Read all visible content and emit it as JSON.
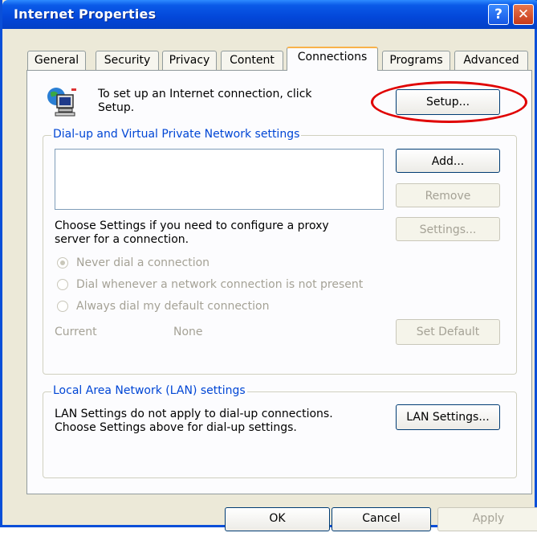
{
  "window": {
    "title": "Internet Properties",
    "help_glyph": "?",
    "close_glyph": "✕"
  },
  "tabs": [
    {
      "label": "General"
    },
    {
      "label": "Security"
    },
    {
      "label": "Privacy"
    },
    {
      "label": "Content"
    },
    {
      "label": "Connections",
      "active": true
    },
    {
      "label": "Programs"
    },
    {
      "label": "Advanced"
    }
  ],
  "setup": {
    "icon": "globe-computer-icon",
    "text_line1": "To set up an Internet connection, click",
    "text_line2": "Setup.",
    "button": "Setup..."
  },
  "dialup": {
    "legend": "Dial-up and Virtual Private Network settings",
    "add": "Add...",
    "remove": "Remove",
    "settings": "Settings...",
    "proxy_line1": "Choose Settings if you need to configure a proxy",
    "proxy_line2": "server for a connection.",
    "options": [
      {
        "label": "Never dial a connection",
        "selected": true
      },
      {
        "label": "Dial whenever a network connection is not present",
        "selected": false
      },
      {
        "label": "Always dial my default connection",
        "selected": false
      }
    ],
    "current_label": "Current",
    "current_value": "None",
    "set_default": "Set Default"
  },
  "lan": {
    "legend": "Local Area Network (LAN) settings",
    "text_line1": "LAN Settings do not apply to dial-up connections.",
    "text_line2": "Choose Settings above for dial-up settings.",
    "button": "LAN Settings..."
  },
  "footer": {
    "ok": "OK",
    "cancel": "Cancel",
    "apply": "Apply"
  },
  "colors": {
    "title_bar": "#0a5ae8",
    "legend": "#0046d5",
    "highlight": "#e00000"
  }
}
